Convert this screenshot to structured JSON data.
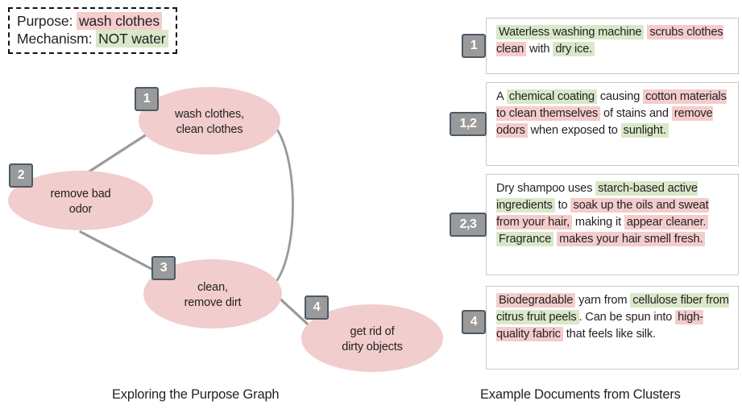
{
  "legend": {
    "purpose_label": "Purpose:",
    "purpose_value": "wash clothes",
    "mechanism_label": "Mechanism:",
    "mechanism_value": "NOT water",
    "purpose_color": "#f4cccc",
    "mechanism_color": "#d9e8c8"
  },
  "graph": {
    "caption": "Exploring the Purpose Graph",
    "node_fill": "#f1cdcd",
    "edge_color": "#9a9a9a",
    "badge_fill": "#9a9a9a",
    "badge_border": "#4a5a68",
    "nodes": [
      {
        "id": "1",
        "badge": "1",
        "line1": "wash clothes,",
        "line2": "clean clothes"
      },
      {
        "id": "2",
        "badge": "2",
        "line1": "remove bad",
        "line2": "odor"
      },
      {
        "id": "3",
        "badge": "3",
        "line1": "clean,",
        "line2": "remove dirt"
      },
      {
        "id": "4",
        "badge": "4",
        "line1": "get rid of",
        "line2": "dirty objects"
      }
    ],
    "edges": [
      {
        "from": "2",
        "to": "1"
      },
      {
        "from": "2",
        "to": "3"
      },
      {
        "from": "1",
        "to": "4"
      },
      {
        "from": "3",
        "to": "4"
      }
    ]
  },
  "documents": {
    "caption": "Example Documents from Clusters",
    "pink": "#f4cccc",
    "green": "#d9e8c8",
    "cards": [
      {
        "badge": "1",
        "segments": [
          {
            "text": "Waterless washing machine",
            "hl": "green"
          },
          {
            "text": " ",
            "hl": "none"
          },
          {
            "text": "scrubs clothes clean",
            "hl": "pink"
          },
          {
            "text": " with ",
            "hl": "none"
          },
          {
            "text": "dry ice.",
            "hl": "green"
          }
        ]
      },
      {
        "badge": "1,2",
        "segments": [
          {
            "text": "A ",
            "hl": "none"
          },
          {
            "text": "chemical coating",
            "hl": "green"
          },
          {
            "text": " causing ",
            "hl": "none"
          },
          {
            "text": "cotton materials to clean themselves",
            "hl": "pink"
          },
          {
            "text": " of stains and ",
            "hl": "none"
          },
          {
            "text": "remove odors",
            "hl": "pink"
          },
          {
            "text": " when exposed to ",
            "hl": "none"
          },
          {
            "text": "sunlight.",
            "hl": "green"
          }
        ]
      },
      {
        "badge": "2,3",
        "segments": [
          {
            "text": "Dry shampoo uses ",
            "hl": "none"
          },
          {
            "text": "starch-based active ingredients",
            "hl": "green"
          },
          {
            "text": " to ",
            "hl": "none"
          },
          {
            "text": "soak up the oils and sweat from your hair,",
            "hl": "pink"
          },
          {
            "text": " making it ",
            "hl": "none"
          },
          {
            "text": "appear cleaner.",
            "hl": "pink"
          },
          {
            "text": " ",
            "hl": "none"
          },
          {
            "text": "Fragrance",
            "hl": "green"
          },
          {
            "text": " ",
            "hl": "none"
          },
          {
            "text": "makes your hair smell fresh.",
            "hl": "pink"
          }
        ]
      },
      {
        "badge": "4",
        "segments": [
          {
            "text": "Biodegradable",
            "hl": "pink"
          },
          {
            "text": " yarn from ",
            "hl": "none"
          },
          {
            "text": "cellulose fiber from citrus fruit peels",
            "hl": "green"
          },
          {
            "text": ". Can be spun into ",
            "hl": "none"
          },
          {
            "text": "high-quality fabric",
            "hl": "pink"
          },
          {
            "text": " that feels like silk.",
            "hl": "none"
          }
        ]
      }
    ]
  }
}
